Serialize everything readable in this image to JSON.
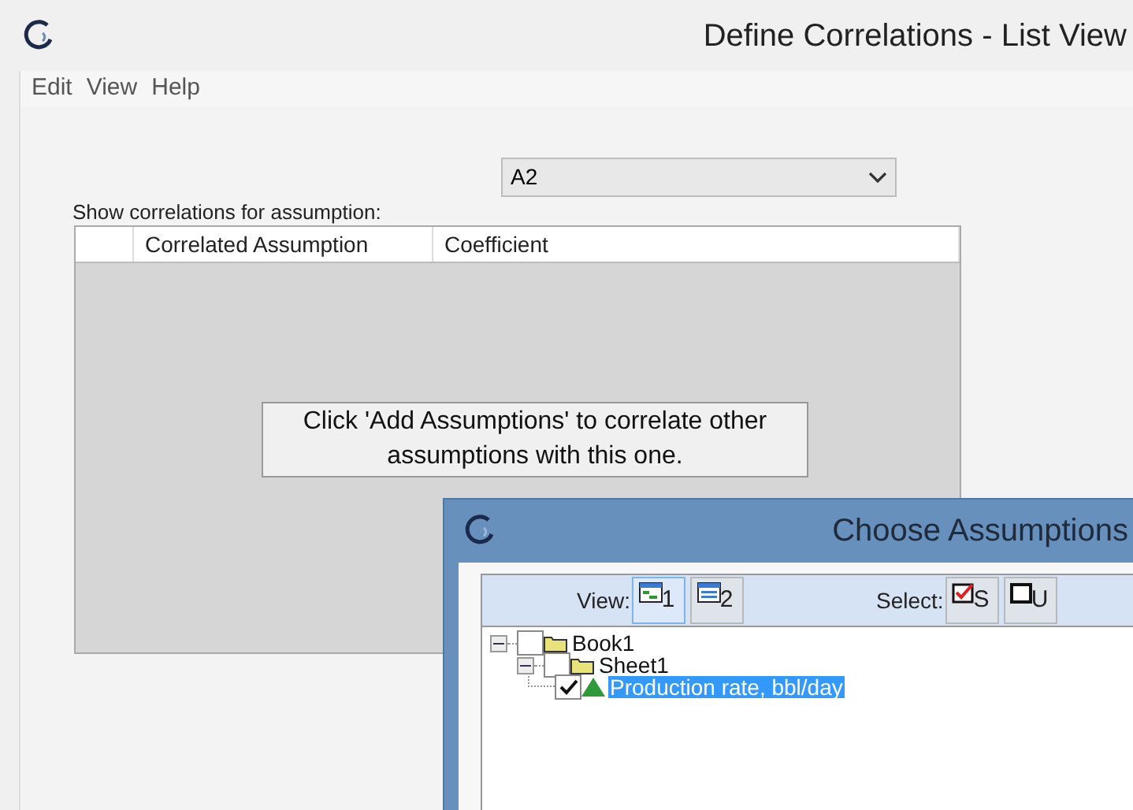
{
  "window": {
    "title": "Define Correlations - List View"
  },
  "menu": [
    "Edit",
    "View",
    "Help"
  ],
  "assumption_dropdown": {
    "value": "A2"
  },
  "show_label": "Show correlations for assumption:",
  "table": {
    "columns": [
      "",
      "Correlated Assumption",
      "Coefficient"
    ],
    "empty_message": "Click 'Add Assumptions' to correlate other assumptions with this one."
  },
  "dialog": {
    "title": "Choose Assumptions",
    "toolbar": {
      "view_label": "View:",
      "view_buttons": [
        {
          "label": "1",
          "kind": "tree",
          "selected": true
        },
        {
          "label": "2",
          "kind": "list",
          "selected": false
        }
      ],
      "select_label": "Select:",
      "select_buttons": [
        {
          "label": "S",
          "kind": "check"
        },
        {
          "label": "U",
          "kind": "uncheck"
        }
      ]
    },
    "tree": [
      {
        "label": "Book1",
        "kind": "folder",
        "checked": false,
        "expanded": true,
        "selected": false,
        "children": [
          {
            "label": "Sheet1",
            "kind": "folder",
            "checked": false,
            "expanded": true,
            "selected": false,
            "children": [
              {
                "label": "Production rate, bbl/day",
                "kind": "assumption",
                "checked": true,
                "selected": true
              }
            ]
          }
        ]
      }
    ]
  }
}
